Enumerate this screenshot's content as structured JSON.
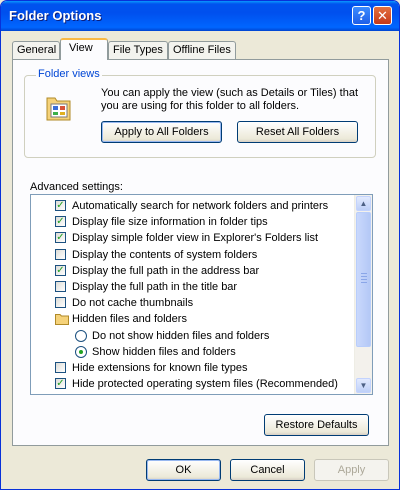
{
  "window": {
    "title": "Folder Options",
    "help": "?",
    "close": "✕"
  },
  "tabs": [
    "General",
    "View",
    "File Types",
    "Offline Files"
  ],
  "folder_views": {
    "legend": "Folder views",
    "description": "You can apply the view (such as Details or Tiles) that you are using for this folder to all folders.",
    "apply_button": "Apply to All Folders",
    "reset_button": "Reset All Folders"
  },
  "advanced": {
    "label": "Advanced settings:",
    "items": [
      {
        "type": "checkbox",
        "checked": true,
        "label": "Automatically search for network folders and printers"
      },
      {
        "type": "checkbox",
        "checked": true,
        "label": "Display file size information in folder tips"
      },
      {
        "type": "checkbox",
        "checked": true,
        "label": "Display simple folder view in Explorer's Folders list"
      },
      {
        "type": "checkbox",
        "checked": false,
        "label": "Display the contents of system folders"
      },
      {
        "type": "checkbox",
        "checked": true,
        "label": "Display the full path in the address bar"
      },
      {
        "type": "checkbox",
        "checked": false,
        "label": "Display the full path in the title bar"
      },
      {
        "type": "checkbox",
        "checked": false,
        "label": "Do not cache thumbnails"
      },
      {
        "type": "folder",
        "label": "Hidden files and folders",
        "icon": "folder-icon"
      },
      {
        "type": "radio",
        "checked": false,
        "label": "Do not show hidden files and folders"
      },
      {
        "type": "radio",
        "checked": true,
        "label": "Show hidden files and folders"
      },
      {
        "type": "checkbox",
        "checked": false,
        "label": "Hide extensions for known file types"
      },
      {
        "type": "checkbox",
        "checked": true,
        "label": "Hide protected operating system files (Recommended)"
      }
    ],
    "scroll_position": 0
  },
  "restore_button": "Restore Defaults",
  "footer": {
    "ok": "OK",
    "cancel": "Cancel",
    "apply": "Apply"
  },
  "colors": {
    "title_bar": "#0053ee",
    "legend": "#0046d5",
    "check": "#21a121",
    "face": "#ece9d8"
  }
}
